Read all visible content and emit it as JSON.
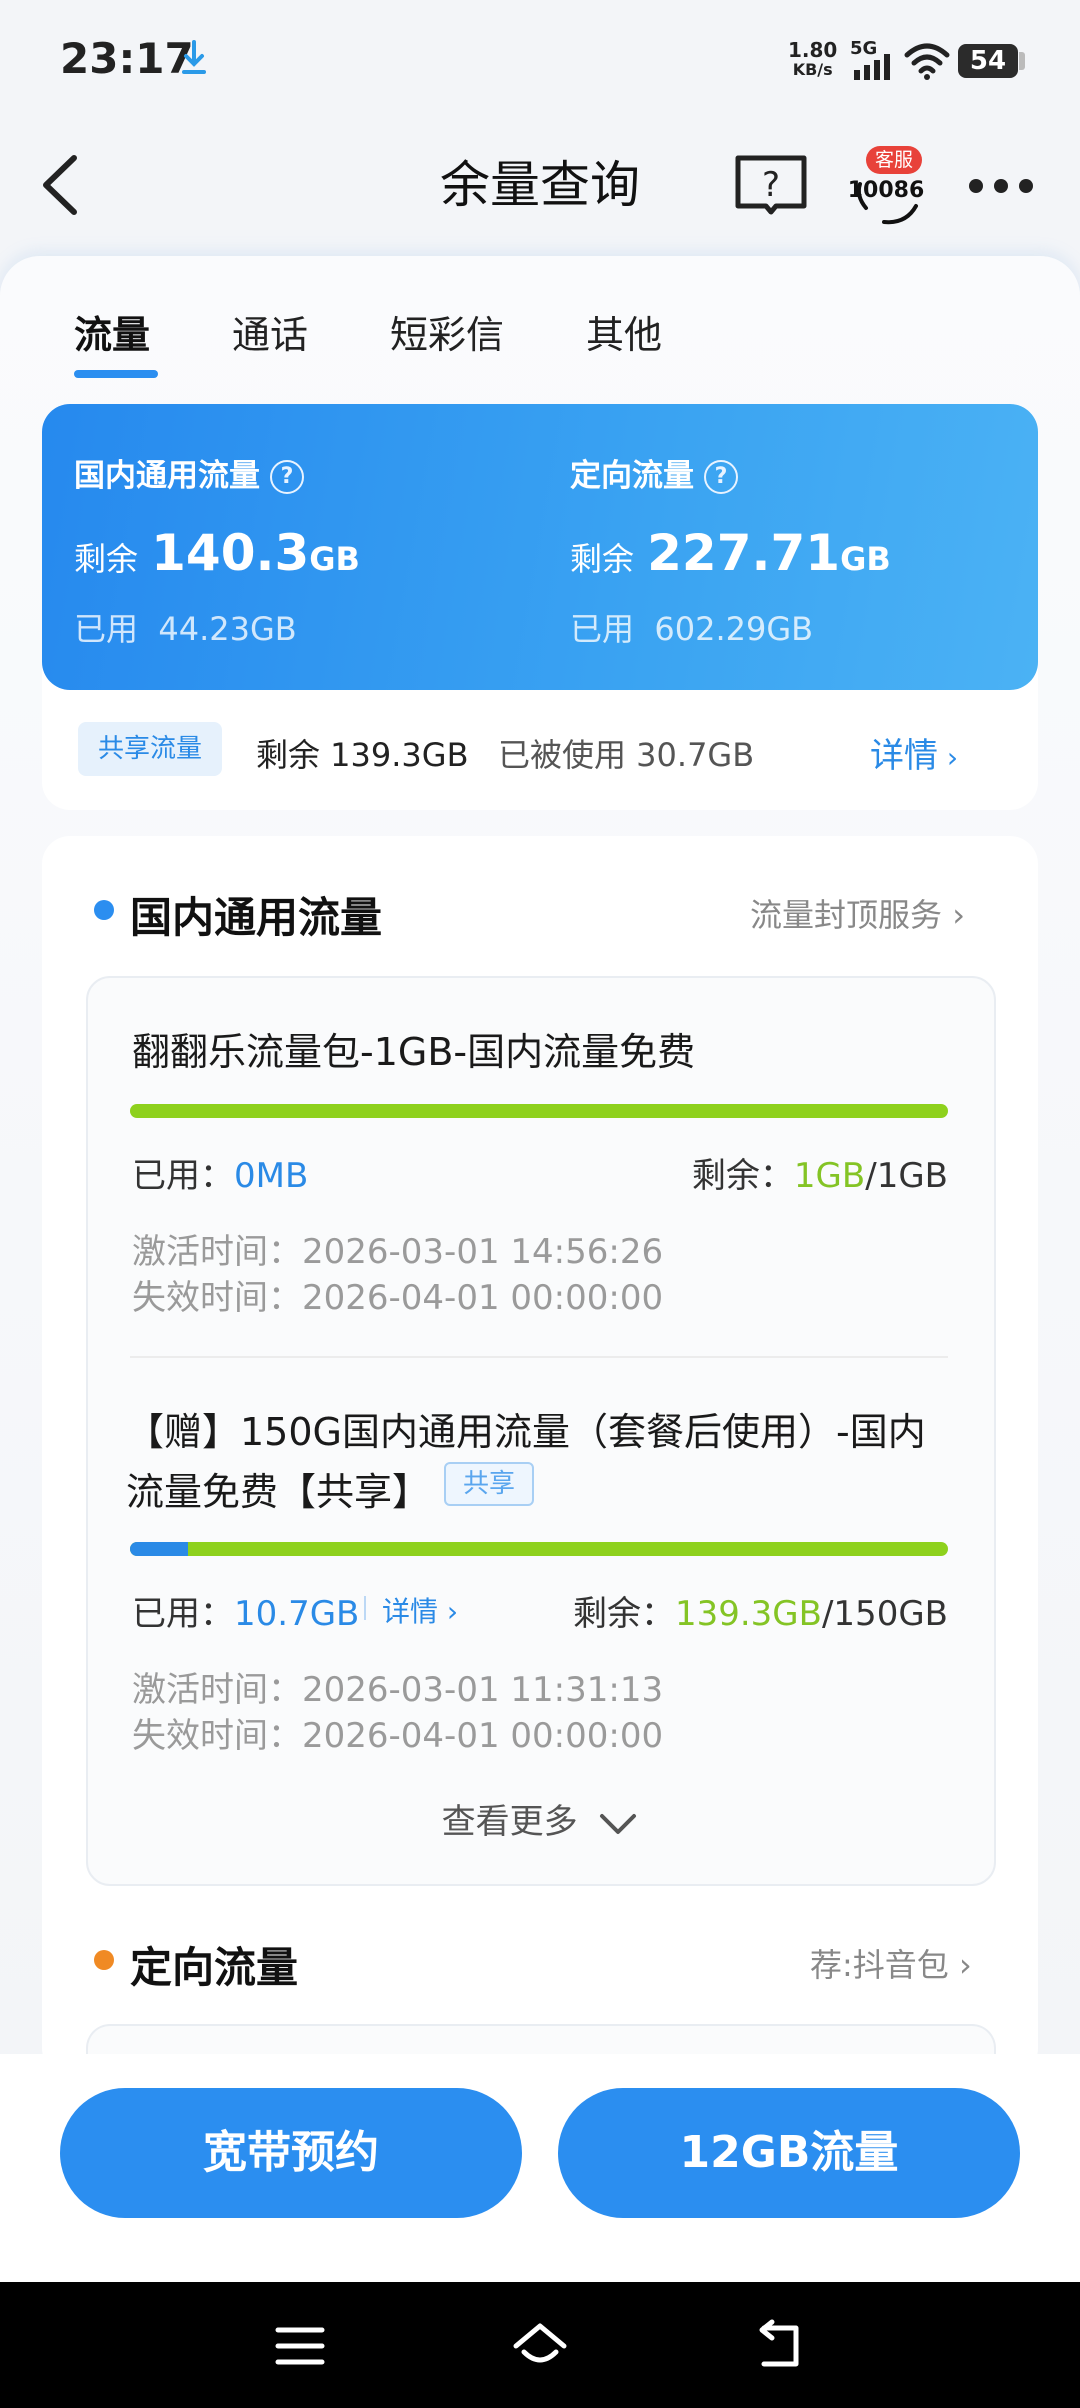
{
  "status_bar": {
    "time": "23:17",
    "net_speed_value": "1.80",
    "net_speed_unit": "KB/s",
    "network_type": "5G",
    "battery": "54"
  },
  "header": {
    "title": "余量查询",
    "cs_badge": "客服",
    "cs_number": "10086"
  },
  "tabs": [
    {
      "label": "流量",
      "active": true
    },
    {
      "label": "通话"
    },
    {
      "label": "短彩信"
    },
    {
      "label": "其他"
    }
  ],
  "summary": {
    "general": {
      "title": "国内通用流量",
      "remain_label": "剩余",
      "remain_value": "140.3",
      "remain_unit": "GB",
      "used_label": "已用",
      "used_value": "44.23GB"
    },
    "targeted": {
      "title": "定向流量",
      "remain_label": "剩余",
      "remain_value": "227.71",
      "remain_unit": "GB",
      "used_label": "已用",
      "used_value": "602.29GB"
    },
    "shared": {
      "badge": "共享流量",
      "remain": "剩余 139.3GB",
      "used": "已被使用 30.7GB",
      "detail": "详情"
    }
  },
  "domestic_section": {
    "title": "国内通用流量",
    "link": "流量封顶服务",
    "packages": [
      {
        "name": "翻翻乐流量包-1GB-国内流量免费",
        "used_progress": 0.0,
        "used_label": "已用：",
        "used_value": "0MB",
        "remain_label": "剩余：",
        "remain_value": "1GB",
        "total": "/1GB",
        "activate": "激活时间：2026-03-01 14:56:26",
        "expire": "失效时间：2026-04-01 00:00:00"
      },
      {
        "name_line1": "【赠】150G国内通用流量（套餐后使用）-国内",
        "name_line2": "流量免费【共享】",
        "tag": "共享",
        "used_progress": 0.071,
        "used_label": "已用：",
        "used_value": "10.7GB",
        "detail": "详情",
        "remain_label": "剩余：",
        "remain_value": "139.3GB",
        "total": "/150GB",
        "activate": "激活时间：2026-03-01 11:31:13",
        "expire": "失效时间：2026-04-01 00:00:00"
      }
    ],
    "see_more": "查看更多"
  },
  "targeted_section": {
    "title": "定向流量",
    "link": "荐:抖音包"
  },
  "buttons": {
    "broadband": "宽带预约",
    "data": "12GB流量"
  },
  "colors": {
    "primary": "#2b8ef0",
    "green": "#84c425",
    "orange": "#f08a24"
  }
}
